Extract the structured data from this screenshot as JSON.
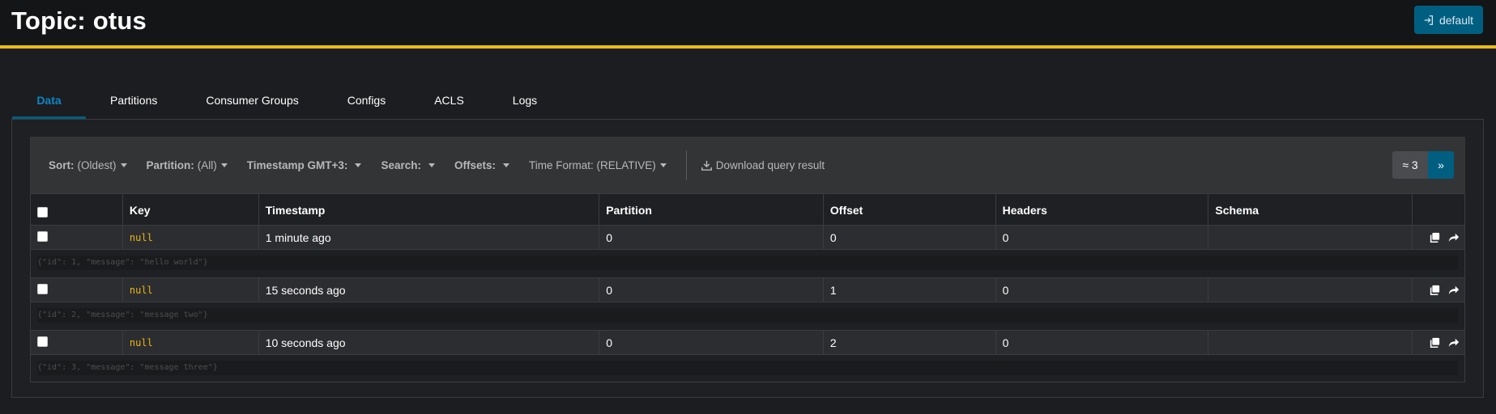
{
  "header": {
    "title": "Topic: otus",
    "cluster_label": "default",
    "cluster_icon": "sign-in-icon",
    "accent_color": "#ecbb13",
    "button_color": "#005f81"
  },
  "tabs": [
    {
      "label": "Data",
      "active": true
    },
    {
      "label": "Partitions",
      "active": false
    },
    {
      "label": "Consumer Groups",
      "active": false
    },
    {
      "label": "Configs",
      "active": false
    },
    {
      "label": "ACLS",
      "active": false
    },
    {
      "label": "Logs",
      "active": false
    }
  ],
  "toolbar": {
    "sort_label": "Sort:",
    "sort_value": "(Oldest)",
    "partition_label": "Partition:",
    "partition_value": "(All)",
    "timestamp_label": "Timestamp GMT+3:",
    "search_label": "Search:",
    "offsets_label": "Offsets:",
    "time_format": "Time Format: (RELATIVE)",
    "download_label": "Download query result",
    "download_icon": "download-icon",
    "count_label": "≈ 3",
    "next_label": "»"
  },
  "table": {
    "columns": [
      "Key",
      "Timestamp",
      "Partition",
      "Offset",
      "Headers",
      "Schema"
    ],
    "rows": [
      {
        "key": "null",
        "timestamp": "1 minute ago",
        "partition": "0",
        "offset": "0",
        "headers": "0",
        "schema": "",
        "value": "{\"id\": 1, \"message\": \"hello world\"}"
      },
      {
        "key": "null",
        "timestamp": "15 seconds ago",
        "partition": "0",
        "offset": "1",
        "headers": "0",
        "schema": "",
        "value": "{\"id\": 2, \"message\": \"message two\"}"
      },
      {
        "key": "null",
        "timestamp": "10 seconds ago",
        "partition": "0",
        "offset": "2",
        "headers": "0",
        "schema": "",
        "value": "{\"id\": 3, \"message\": \"message three\"}"
      }
    ],
    "row_icons": [
      "copy-icon",
      "share-icon"
    ]
  }
}
